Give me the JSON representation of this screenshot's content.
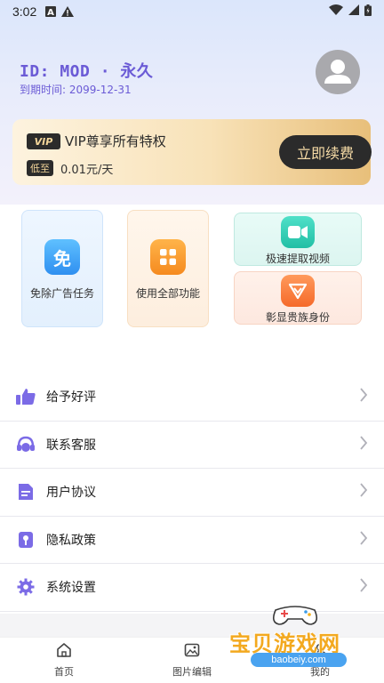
{
  "status_bar": {
    "time": "3:02"
  },
  "profile": {
    "user_id": "ID: MOD · 永久",
    "expire": "到期时间: 2099-12-31"
  },
  "vip_card": {
    "badge": "VIP",
    "title": "VIP尊享所有特权",
    "price_tag": "低至",
    "price": "0.01元/天",
    "renew_label": "立即续费"
  },
  "features": [
    {
      "label": "免除广告任务",
      "icon": "free-icon",
      "icon_text": "免",
      "color": "#3aa6f5"
    },
    {
      "label": "使用全部功能",
      "icon": "grid-icon",
      "color": "#f59a2a"
    },
    {
      "label": "极速提取视频",
      "icon": "video-icon",
      "color": "#2fcfb8"
    },
    {
      "label": "彰显贵族身份",
      "icon": "vip-crown-icon",
      "color": "#f57b3d"
    }
  ],
  "menu": [
    {
      "label": "给予好评",
      "icon": "thumbs-up-icon"
    },
    {
      "label": "联系客服",
      "icon": "headset-icon"
    },
    {
      "label": "用户协议",
      "icon": "document-icon"
    },
    {
      "label": "隐私政策",
      "icon": "lock-icon"
    },
    {
      "label": "系统设置",
      "icon": "gear-icon"
    }
  ],
  "bottom_nav": [
    {
      "label": "首页",
      "icon": "home-icon"
    },
    {
      "label": "图片编辑",
      "icon": "image-edit-icon"
    },
    {
      "label": "我的",
      "icon": "profile-icon"
    }
  ],
  "watermark": {
    "text": "宝贝游戏网",
    "url": "baobeiy.com"
  },
  "colors": {
    "accent": "#6b5bd6",
    "gold": "#e8bf7a",
    "dark": "#2b2b2b"
  }
}
